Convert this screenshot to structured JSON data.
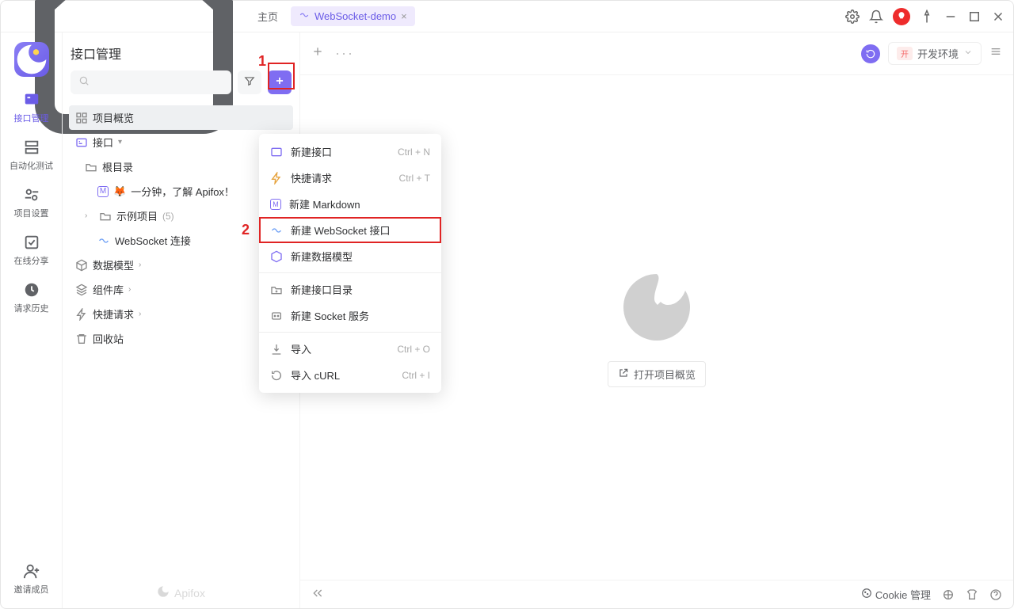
{
  "titlebar": {
    "home": "主页",
    "tab_icon_color": "#8b7ff5",
    "tab_label": "WebSocket-demo"
  },
  "nav": {
    "items": [
      {
        "label": "接口管理",
        "active": true
      },
      {
        "label": "自动化测试",
        "active": false
      },
      {
        "label": "项目设置",
        "active": false
      },
      {
        "label": "在线分享",
        "active": false
      },
      {
        "label": "请求历史",
        "active": false
      },
      {
        "label": "邀请成员",
        "active": false
      }
    ]
  },
  "sidebar": {
    "title": "接口管理",
    "tree": {
      "project_overview": "项目概览",
      "api_root_label": "接口",
      "root_folder": "根目录",
      "doc_item": "一分钟，了解 Apifox！",
      "example_project": "示例项目",
      "example_count": "(5)",
      "websocket_conn": "WebSocket 连接",
      "data_model": "数据模型",
      "component_lib": "组件库",
      "quick_request": "快捷请求",
      "recycle_bin": "回收站"
    },
    "footer_brand": "Apifox"
  },
  "menu": {
    "items": [
      {
        "icon": "api",
        "label": "新建接口",
        "shortcut": "Ctrl + N"
      },
      {
        "icon": "bolt",
        "label": "快捷请求",
        "shortcut": "Ctrl + T"
      },
      {
        "icon": "md",
        "label": "新建 Markdown",
        "shortcut": ""
      },
      {
        "icon": "ws",
        "label": "新建 WebSocket 接口",
        "shortcut": "",
        "highlight": true
      },
      {
        "icon": "cube",
        "label": "新建数据模型",
        "shortcut": ""
      },
      {
        "sep": true
      },
      {
        "icon": "folder-plus",
        "label": "新建接口目录",
        "shortcut": ""
      },
      {
        "icon": "socket",
        "label": "新建 Socket 服务",
        "shortcut": ""
      },
      {
        "sep": true
      },
      {
        "icon": "import",
        "label": "导入",
        "shortcut": "Ctrl + O"
      },
      {
        "icon": "curl",
        "label": "导入 cURL",
        "shortcut": "Ctrl + I"
      }
    ]
  },
  "content": {
    "env_label": "开发环境",
    "env_pill": "开",
    "open_project": "打开项目概览"
  },
  "footer": {
    "cookie": "Cookie 管理"
  },
  "callouts": {
    "one": "1",
    "two": "2"
  }
}
